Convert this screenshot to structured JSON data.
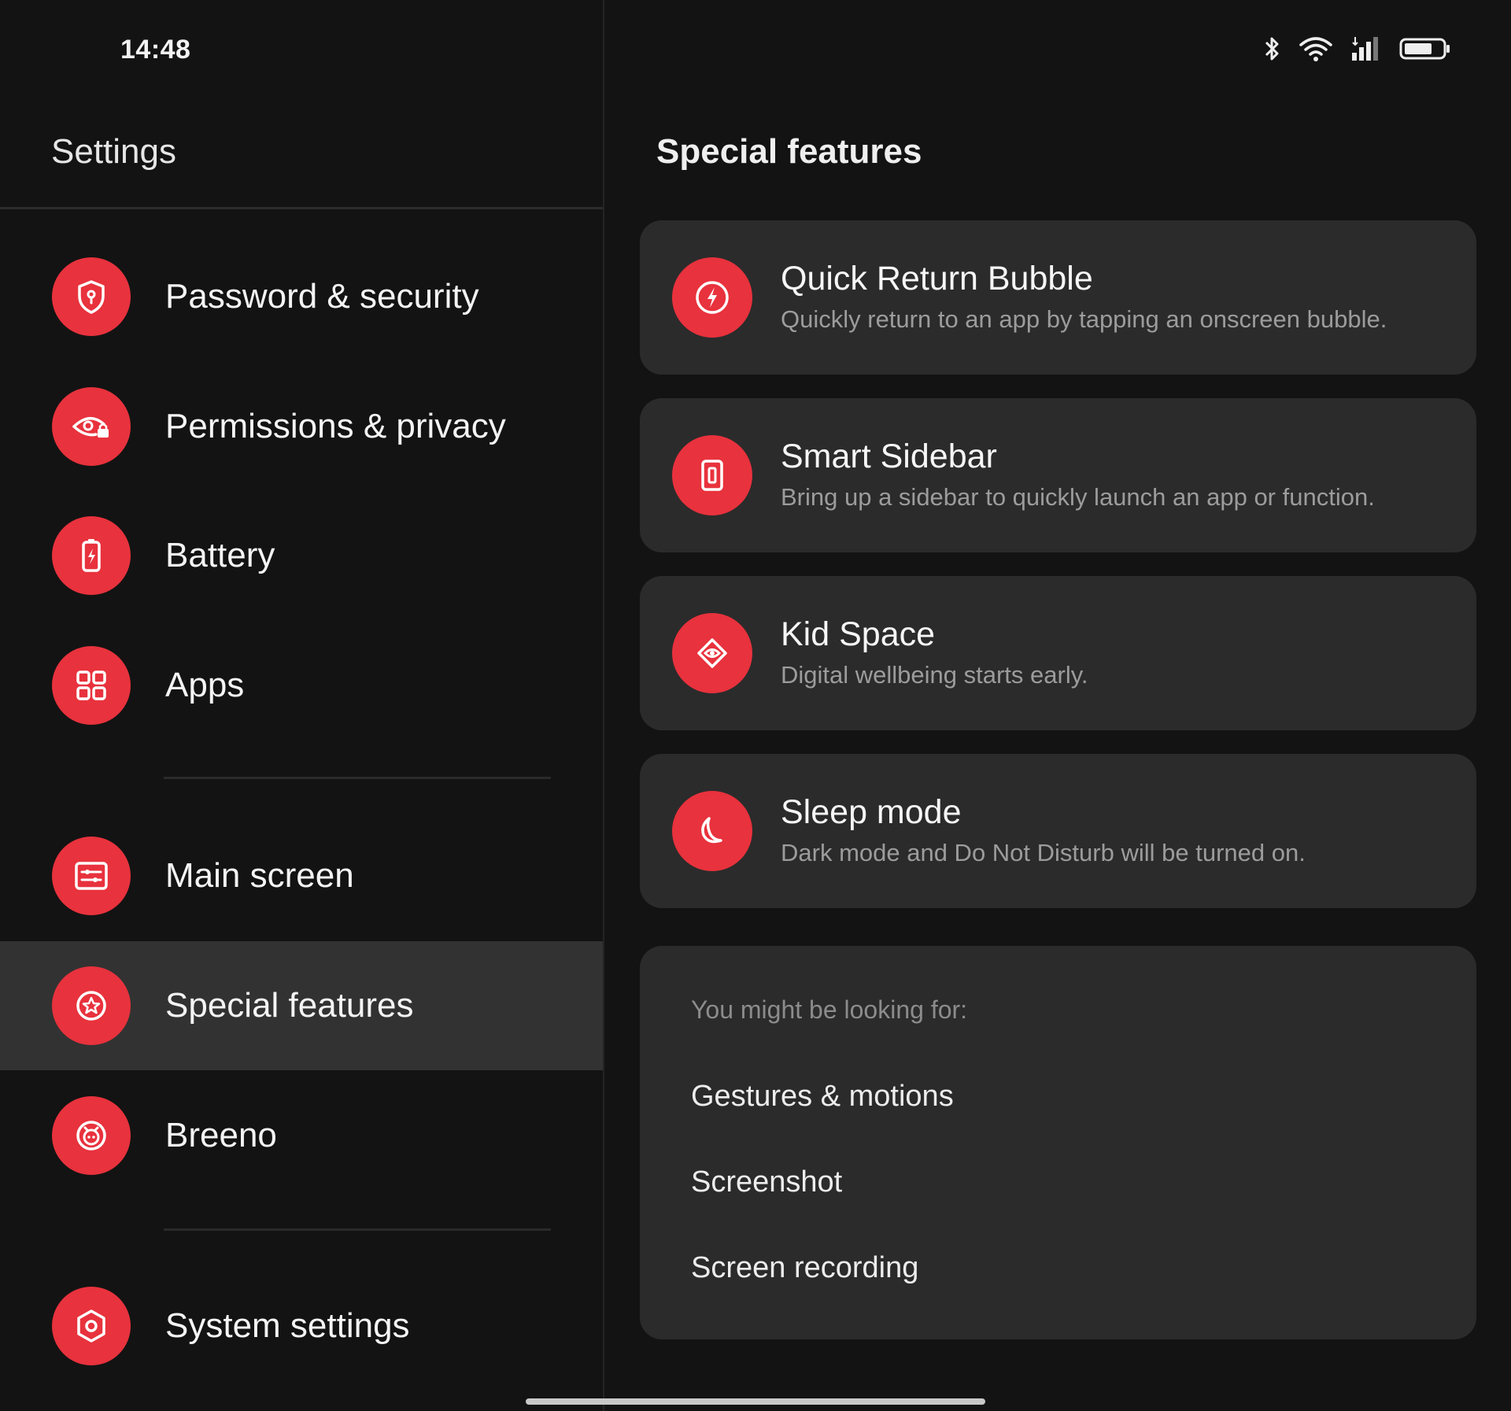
{
  "status_bar": {
    "time": "14:48",
    "icons": [
      "bluetooth-icon",
      "wifi-icon",
      "cellular-signal-icon",
      "battery-icon"
    ]
  },
  "sidebar": {
    "title": "Settings",
    "items": [
      {
        "label": "Password & security",
        "icon": "shield-icon"
      },
      {
        "label": "Permissions & privacy",
        "icon": "eye-lock-icon"
      },
      {
        "label": "Battery",
        "icon": "battery-icon"
      },
      {
        "label": "Apps",
        "icon": "apps-grid-icon"
      },
      {
        "label": "Main screen",
        "icon": "home-screen-icon"
      },
      {
        "label": "Special features",
        "icon": "star-icon",
        "selected": true
      },
      {
        "label": "Breeno",
        "icon": "assistant-icon"
      },
      {
        "label": "System settings",
        "icon": "gear-icon"
      }
    ]
  },
  "main": {
    "title": "Special features",
    "features": [
      {
        "title": "Quick Return Bubble",
        "description": "Quickly return to an app by tapping an onscreen bubble.",
        "icon": "bolt-icon"
      },
      {
        "title": "Smart Sidebar",
        "description": "Bring up a sidebar to quickly launch an app or function.",
        "icon": "sidebar-icon"
      },
      {
        "title": "Kid Space",
        "description": "Digital wellbeing starts early.",
        "icon": "kid-face-icon"
      },
      {
        "title": "Sleep mode",
        "description": "Dark mode and Do Not Disturb will be turned on.",
        "icon": "moon-icon"
      }
    ],
    "suggestions": {
      "heading": "You might be looking for:",
      "links": [
        "Gestures & motions",
        "Screenshot",
        "Screen recording"
      ]
    }
  },
  "colors": {
    "accent": "#e8323d",
    "background": "#131313",
    "card": "#2b2b2b",
    "selected_row": "#323232"
  }
}
